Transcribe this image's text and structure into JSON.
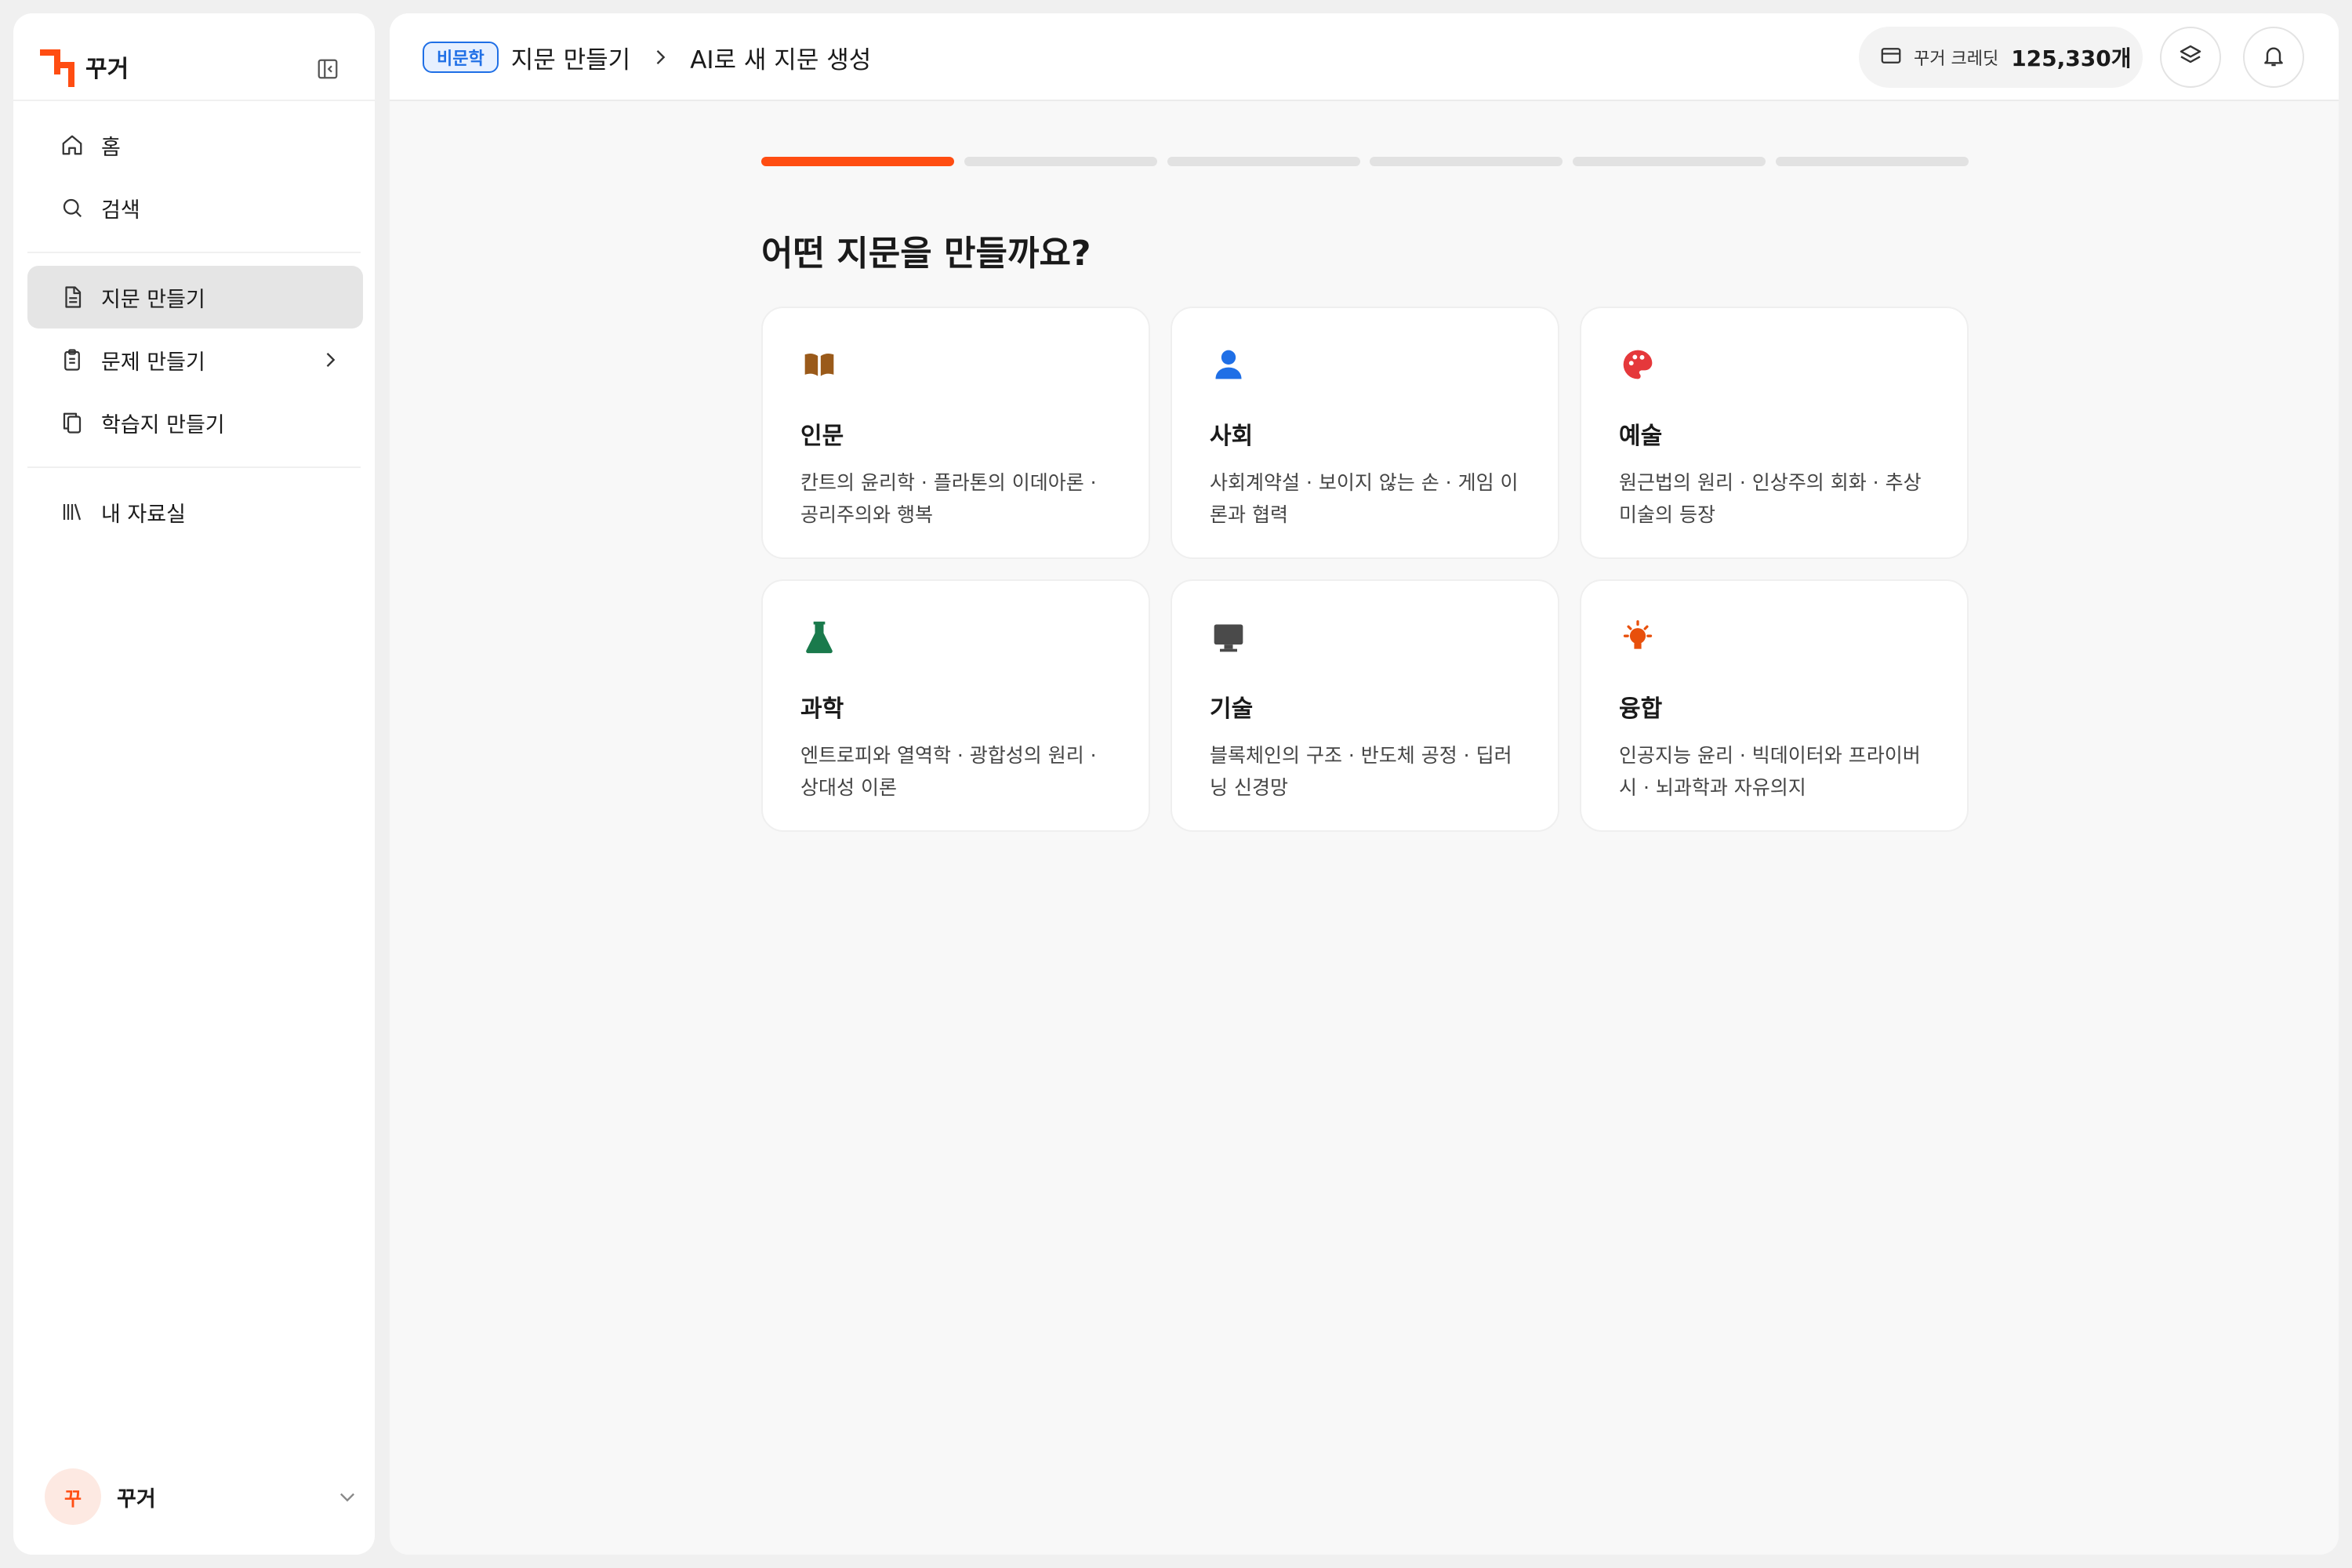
{
  "app": {
    "name": "꾸거",
    "brand_color": "#ff4d12"
  },
  "sidebar": {
    "nav_top": [
      {
        "label": "홈",
        "icon": "home-icon"
      },
      {
        "label": "검색",
        "icon": "search-icon"
      }
    ],
    "nav_create": [
      {
        "label": "지문 만들기",
        "icon": "document-icon",
        "active": true
      },
      {
        "label": "문제 만들기",
        "icon": "clipboard-icon",
        "has_submenu": true
      },
      {
        "label": "학습지 만들기",
        "icon": "copy-icon"
      }
    ],
    "nav_library": [
      {
        "label": "내 자료실",
        "icon": "library-icon"
      }
    ],
    "user": {
      "avatar_text": "꾸",
      "name": "꾸거"
    }
  },
  "header": {
    "tag": "비문학",
    "breadcrumb": [
      "지문 만들기",
      "AI로 새 지문 생성"
    ],
    "credit_label": "꾸거 크레딧",
    "credit_value": "125,330개"
  },
  "progress": {
    "steps": 6,
    "current": 1
  },
  "question": "어떤 지문을 만들까요?",
  "categories": [
    {
      "title": "인문",
      "desc": "칸트의 윤리학 · 플라톤의 이데아론 · 공리주의와 행복",
      "icon": "book-icon",
      "color": "#9a5a1a"
    },
    {
      "title": "사회",
      "desc": "사회계약설 · 보이지 않는 손 · 게임 이론과 협력",
      "icon": "person-icon",
      "color": "#1f6fe6"
    },
    {
      "title": "예술",
      "desc": "원근법의 원리 · 인상주의 회화 · 추상 미술의 등장",
      "icon": "palette-icon",
      "color": "#e5383b"
    },
    {
      "title": "과학",
      "desc": "엔트로피와 열역학 · 광합성의 원리 · 상대성 이론",
      "icon": "flask-icon",
      "color": "#1a7a4c"
    },
    {
      "title": "기술",
      "desc": "블록체인의 구조 · 반도체 공정 · 딥러닝 신경망",
      "icon": "monitor-icon",
      "color": "#4a4a4a"
    },
    {
      "title": "융합",
      "desc": "인공지능 윤리 · 빅데이터와 프라이버시 · 뇌과학과 자유의지",
      "icon": "lightbulb-icon",
      "color": "#e8500c"
    }
  ]
}
